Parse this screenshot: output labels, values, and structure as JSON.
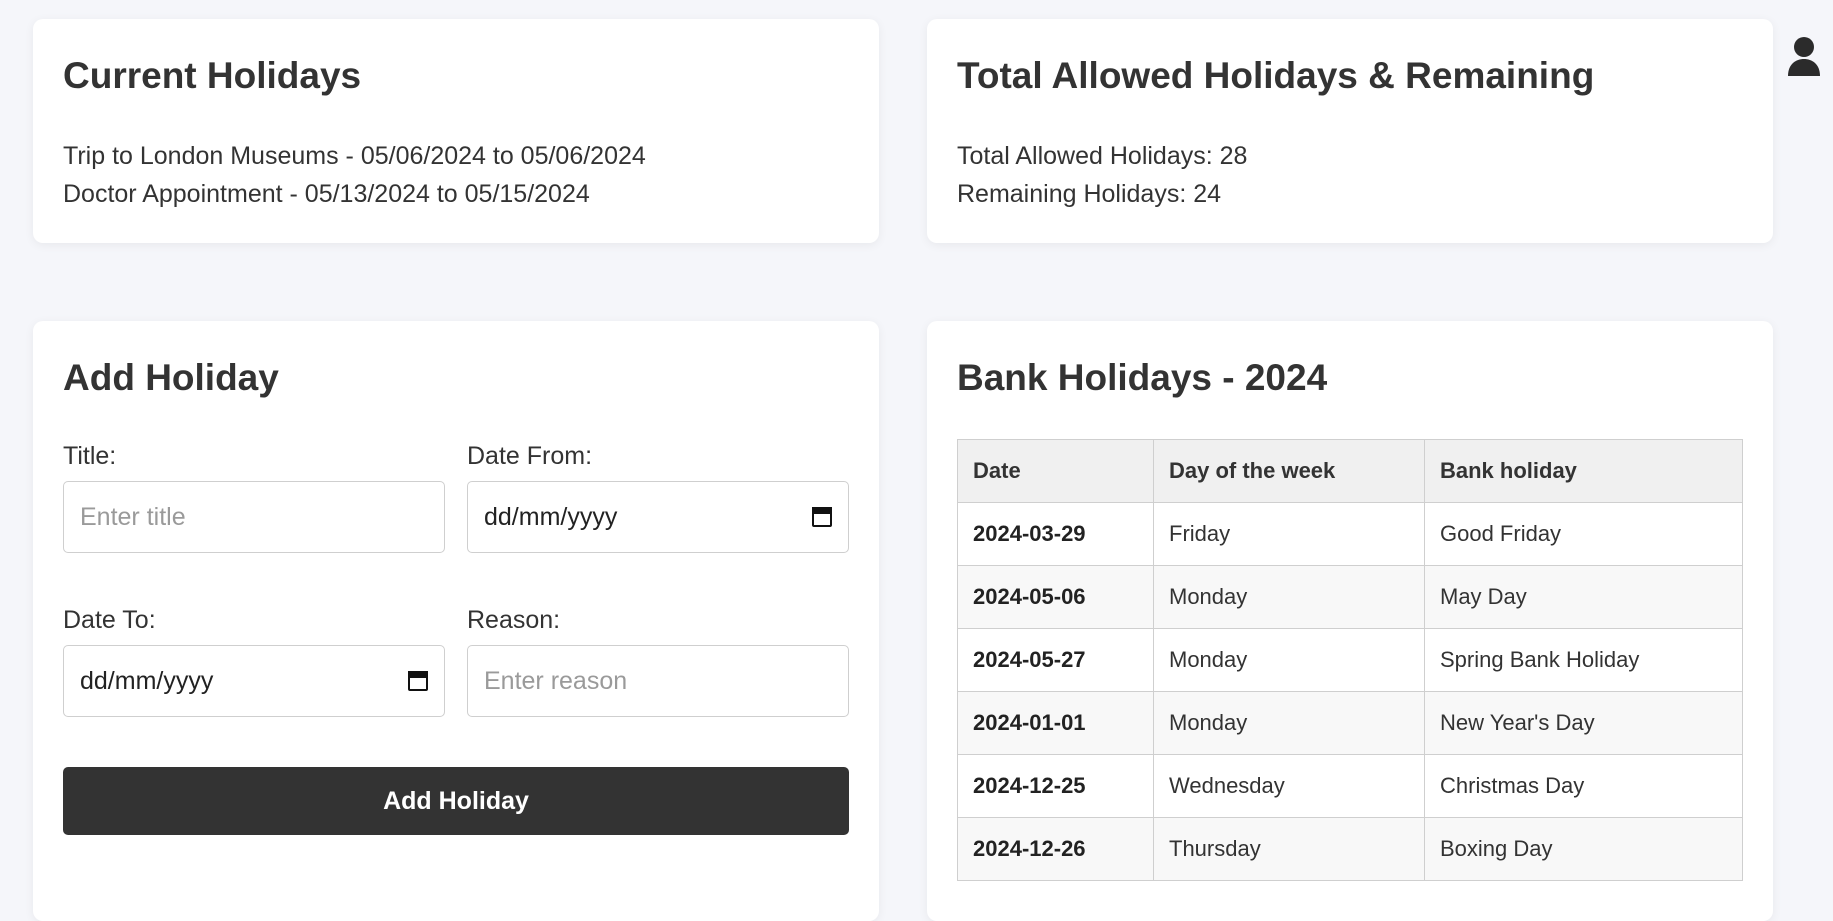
{
  "current_holidays": {
    "title": "Current Holidays",
    "items": [
      "Trip to London Museums - 05/06/2024 to 05/06/2024",
      "Doctor Appointment - 05/13/2024 to 05/15/2024"
    ]
  },
  "totals": {
    "title": "Total Allowed Holidays & Remaining",
    "total_line": "Total Allowed Holidays: 28",
    "remaining_line": "Remaining Holidays: 24"
  },
  "add_holiday": {
    "title": "Add Holiday",
    "title_label": "Title:",
    "title_placeholder": "Enter title",
    "date_from_label": "Date From:",
    "date_from_value": "dd/mm/yyyy",
    "date_to_label": "Date To:",
    "date_to_value": "dd/mm/yyyy",
    "reason_label": "Reason:",
    "reason_placeholder": "Enter reason",
    "button_label": "Add Holiday"
  },
  "bank_holidays": {
    "title": "Bank Holidays - 2024",
    "headers": [
      "Date",
      "Day of the week",
      "Bank holiday"
    ],
    "rows": [
      [
        "2024-03-29",
        "Friday",
        "Good Friday"
      ],
      [
        "2024-05-06",
        "Monday",
        "May Day"
      ],
      [
        "2024-05-27",
        "Monday",
        "Spring Bank Holiday"
      ],
      [
        "2024-01-01",
        "Monday",
        "New Year's Day"
      ],
      [
        "2024-12-25",
        "Wednesday",
        "Christmas Day"
      ],
      [
        "2024-12-26",
        "Thursday",
        "Boxing Day"
      ]
    ]
  },
  "icons": {
    "user": "user-icon",
    "calendar": "calendar-icon"
  }
}
